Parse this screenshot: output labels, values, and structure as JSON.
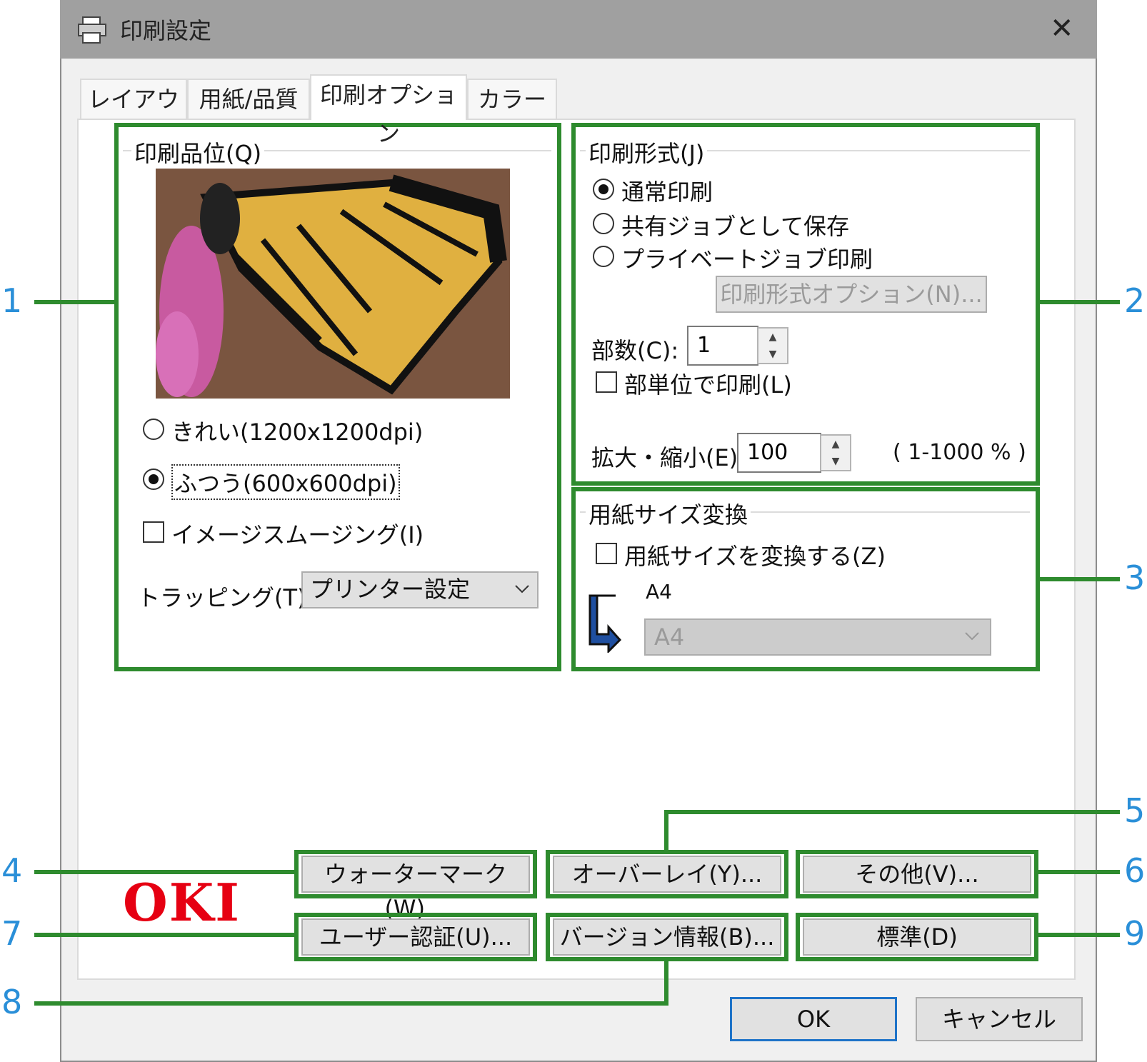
{
  "window": {
    "title": "印刷設定",
    "close_glyph": "✕"
  },
  "tabs": [
    {
      "label": "レイアウト"
    },
    {
      "label": "用紙/品質"
    },
    {
      "label": "印刷オプション"
    },
    {
      "label": "カラー"
    }
  ],
  "quality": {
    "group_label": "印刷品位(Q)",
    "options": [
      {
        "label": "きれい(1200x1200dpi)",
        "selected": false
      },
      {
        "label": "ふつう(600x600dpi)",
        "selected": true
      }
    ],
    "smoothing_label": "イメージスムージング(I)",
    "trapping_label": "トラッピング(T)",
    "trapping_value": "プリンター設定"
  },
  "print_format": {
    "group_label": "印刷形式(J)",
    "options": [
      {
        "label": "通常印刷",
        "selected": true
      },
      {
        "label": "共有ジョブとして保存",
        "selected": false
      },
      {
        "label": "プライベートジョブ印刷",
        "selected": false
      }
    ],
    "options_button": "印刷形式オプション(N)...",
    "copies_label": "部数(C):",
    "copies_value": "1",
    "collate_label": "部単位で印刷(L)",
    "scale_label": "拡大・縮小(E):",
    "scale_value": "100",
    "scale_range": "( 1-1000 % )"
  },
  "paper_convert": {
    "group_label": "用紙サイズ変換",
    "check_label": "用紙サイズを変換する(Z)",
    "source_size": "A4",
    "target_size": "A4"
  },
  "buttons": {
    "watermark": "ウォーターマーク(W)...",
    "overlay": "オーバーレイ(Y)...",
    "other": "その他(V)...",
    "user_auth": "ユーザー認証(U)...",
    "version": "バージョン情報(B)...",
    "default": "標準(D)",
    "ok": "OK",
    "cancel": "キャンセル"
  },
  "brand": {
    "logo": "OKI",
    "color": "#e60012"
  },
  "callouts": [
    "1",
    "2",
    "3",
    "4",
    "5",
    "6",
    "7",
    "8",
    "9"
  ],
  "colors": {
    "highlight_green": "#2e8b2e",
    "callout_blue": "#2a8fd8",
    "ok_border": "#1e73c8"
  }
}
